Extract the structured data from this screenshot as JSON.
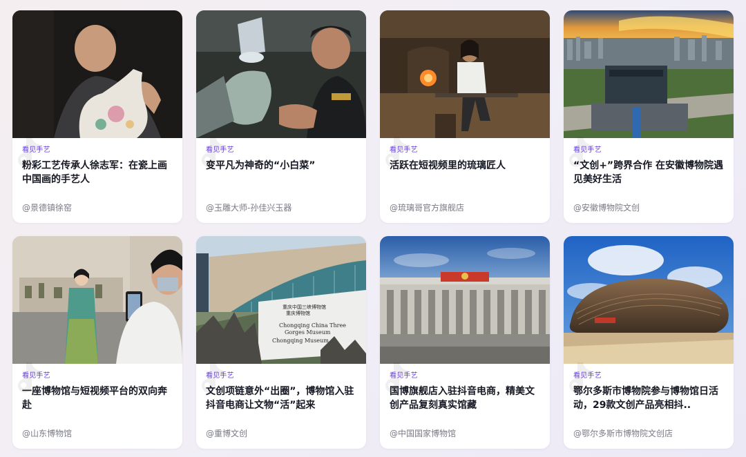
{
  "cards": [
    {
      "tag": "看见手艺",
      "title": "粉彩工艺传承人徐志军：在瓷上画中国画的手艺人",
      "author": "@景德镇徐窑"
    },
    {
      "tag": "看见手艺",
      "title": "变平凡为神奇的“小白菜”",
      "author": "@玉雕大师-孙佳兴玉器"
    },
    {
      "tag": "看见手艺",
      "title": "活跃在短视频里的琉璃匠人",
      "author": "@琉璃哥官方旗舰店"
    },
    {
      "tag": "看见手艺",
      "title": "“文创+”跨界合作 在安徽博物院遇见美好生活",
      "author": "@安徽博物院文创"
    },
    {
      "tag": "看见手艺",
      "title": "一座博物馆与短视频平台的双向奔赴",
      "author": "@山东博物馆"
    },
    {
      "tag": "看见手艺",
      "title": "文创项链意外“出圈”，博物馆入驻抖音电商让文物“活”起来",
      "author": "@重博文创"
    },
    {
      "tag": "看见手艺",
      "title": "国博旗舰店入驻抖音电商，精美文创产品复刻真实馆藏",
      "author": "@中国国家博物馆"
    },
    {
      "tag": "看见手艺",
      "title": "鄂尔多斯市博物院参与博物馆日活动，29款文创产品亮相抖..",
      "author": "@鄂尔多斯市博物院文创店"
    }
  ],
  "images": {
    "sign_line1": "重庆中国三峡博物馆",
    "sign_line2": "重庆博物馆",
    "sign_en1": "Chongqing China Three",
    "sign_en2": "Gorges Museum",
    "sign_en3": "Chongqing Museum"
  },
  "colors": {
    "tag": "#6a3de8",
    "title": "#161823",
    "author": "#7a7b86",
    "card": "#ffffff"
  }
}
